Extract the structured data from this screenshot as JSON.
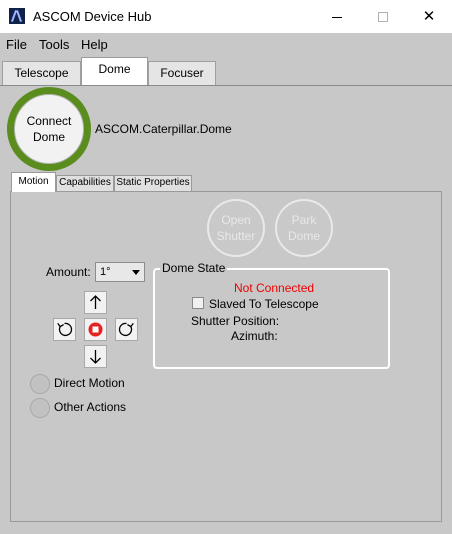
{
  "window": {
    "title": "ASCOM Device Hub",
    "minimize": "–",
    "maximize": "□",
    "close": "✕"
  },
  "menu": [
    "File",
    "Tools",
    "Help"
  ],
  "tabs": [
    "Telescope",
    "Dome",
    "Focuser"
  ],
  "active_tab": "Dome",
  "connect": {
    "label_line1": "Connect",
    "label_line2": "Dome",
    "ring_color": "#5a8c1e"
  },
  "driver_name": "ASCOM.Caterpillar.Dome",
  "subtabs": [
    "Motion",
    "Capabilities",
    "Static Properties"
  ],
  "active_subtab": "Motion",
  "shutter_buttons": {
    "open": {
      "line1": "Open",
      "line2": "Shutter"
    },
    "park": {
      "line1": "Park",
      "line2": "Dome"
    }
  },
  "amount": {
    "label": "Amount:",
    "value": "1°"
  },
  "jog_icons": [
    "arrow-up-icon",
    "rotate-ccw-icon",
    "stop-icon",
    "rotate-cw-icon",
    "arrow-down-icon"
  ],
  "motion_modes": [
    "Direct Motion",
    "Other Actions"
  ],
  "dome_state": {
    "legend": "Dome State",
    "status": "Not Connected",
    "status_color": "#ee0000",
    "slaved_label": "Slaved To Telescope",
    "shutter_position_label": "Shutter Position:",
    "azimuth_label": "Azimuth:"
  }
}
